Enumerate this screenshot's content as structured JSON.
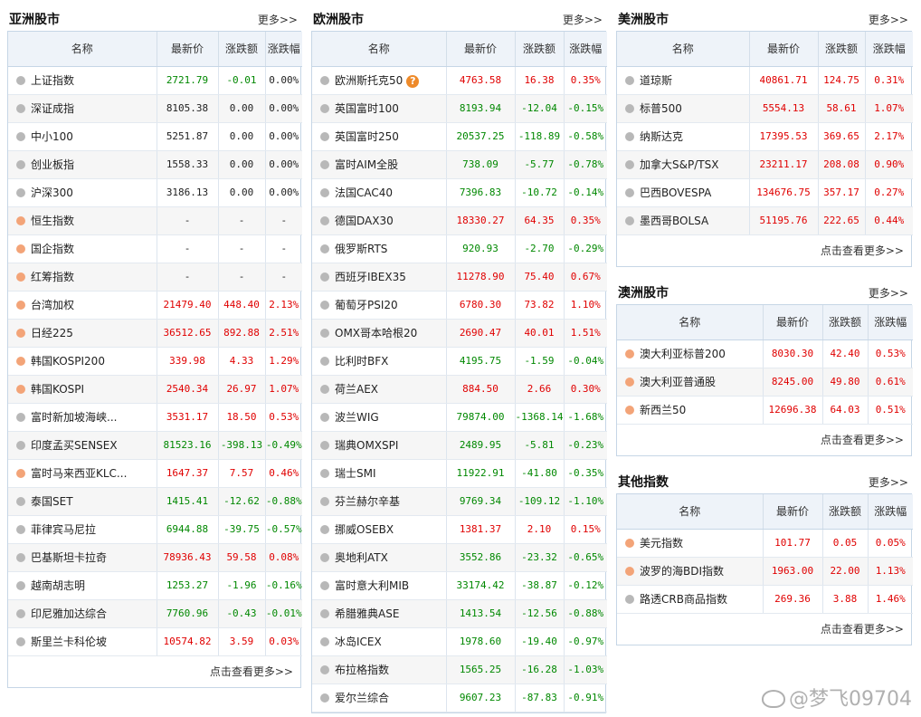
{
  "asia": {
    "title": "亚洲股市",
    "more": "更多>>",
    "headers": [
      "名称",
      "最新价",
      "涨跌额",
      "涨跌幅"
    ],
    "rows": [
      {
        "name": "上证指数",
        "price": "2721.79",
        "change": "-0.01",
        "pct": "0.00%",
        "dot": "gray",
        "dir": "down",
        "pdir": "flat"
      },
      {
        "name": "深证成指",
        "price": "8105.38",
        "change": "0.00",
        "pct": "0.00%",
        "dot": "gray",
        "dir": "flat",
        "pdir": "flat"
      },
      {
        "name": "中小100",
        "price": "5251.87",
        "change": "0.00",
        "pct": "0.00%",
        "dot": "gray",
        "dir": "flat",
        "pdir": "flat"
      },
      {
        "name": "创业板指",
        "price": "1558.33",
        "change": "0.00",
        "pct": "0.00%",
        "dot": "gray",
        "dir": "flat",
        "pdir": "flat"
      },
      {
        "name": "沪深300",
        "price": "3186.13",
        "change": "0.00",
        "pct": "0.00%",
        "dot": "gray",
        "dir": "flat",
        "pdir": "flat"
      },
      {
        "name": "恒生指数",
        "price": "-",
        "change": "-",
        "pct": "-",
        "dot": "orange",
        "dir": "flat",
        "pdir": "flat"
      },
      {
        "name": "国企指数",
        "price": "-",
        "change": "-",
        "pct": "-",
        "dot": "orange",
        "dir": "flat",
        "pdir": "flat"
      },
      {
        "name": "红筹指数",
        "price": "-",
        "change": "-",
        "pct": "-",
        "dot": "orange",
        "dir": "flat",
        "pdir": "flat"
      },
      {
        "name": "台湾加权",
        "price": "21479.40",
        "change": "448.40",
        "pct": "2.13%",
        "dot": "orange",
        "dir": "up",
        "pdir": "up"
      },
      {
        "name": "日经225",
        "price": "36512.65",
        "change": "892.88",
        "pct": "2.51%",
        "dot": "orange",
        "dir": "up",
        "pdir": "up"
      },
      {
        "name": "韩国KOSPI200",
        "price": "339.98",
        "change": "4.33",
        "pct": "1.29%",
        "dot": "orange",
        "dir": "up",
        "pdir": "up"
      },
      {
        "name": "韩国KOSPI",
        "price": "2540.34",
        "change": "26.97",
        "pct": "1.07%",
        "dot": "orange",
        "dir": "up",
        "pdir": "up"
      },
      {
        "name": "富时新加坡海峡...",
        "price": "3531.17",
        "change": "18.50",
        "pct": "0.53%",
        "dot": "gray",
        "dir": "up",
        "pdir": "up"
      },
      {
        "name": "印度孟买SENSEX",
        "price": "81523.16",
        "change": "-398.13",
        "pct": "-0.49%",
        "dot": "gray",
        "dir": "down",
        "pdir": "down"
      },
      {
        "name": "富时马来西亚KLC...",
        "price": "1647.37",
        "change": "7.57",
        "pct": "0.46%",
        "dot": "orange",
        "dir": "up",
        "pdir": "up"
      },
      {
        "name": "泰国SET",
        "price": "1415.41",
        "change": "-12.62",
        "pct": "-0.88%",
        "dot": "gray",
        "dir": "down",
        "pdir": "down"
      },
      {
        "name": "菲律宾马尼拉",
        "price": "6944.88",
        "change": "-39.75",
        "pct": "-0.57%",
        "dot": "gray",
        "dir": "down",
        "pdir": "down"
      },
      {
        "name": "巴基斯坦卡拉奇",
        "price": "78936.43",
        "change": "59.58",
        "pct": "0.08%",
        "dot": "gray",
        "dir": "up",
        "pdir": "up"
      },
      {
        "name": "越南胡志明",
        "price": "1253.27",
        "change": "-1.96",
        "pct": "-0.16%",
        "dot": "gray",
        "dir": "down",
        "pdir": "down"
      },
      {
        "name": "印尼雅加达综合",
        "price": "7760.96",
        "change": "-0.43",
        "pct": "-0.01%",
        "dot": "gray",
        "dir": "down",
        "pdir": "down"
      },
      {
        "name": "斯里兰卡科伦坡",
        "price": "10574.82",
        "change": "3.59",
        "pct": "0.03%",
        "dot": "gray",
        "dir": "up",
        "pdir": "up"
      }
    ],
    "footer": "点击查看更多>>"
  },
  "europe": {
    "title": "欧洲股市",
    "more": "更多>>",
    "headers": [
      "名称",
      "最新价",
      "涨跌额",
      "涨跌幅"
    ],
    "rows": [
      {
        "name": "欧洲斯托克50",
        "price": "4763.58",
        "change": "16.38",
        "pct": "0.35%",
        "dot": "gray",
        "dir": "up",
        "pdir": "up",
        "help": "?"
      },
      {
        "name": "英国富时100",
        "price": "8193.94",
        "change": "-12.04",
        "pct": "-0.15%",
        "dot": "gray",
        "dir": "down",
        "pdir": "down"
      },
      {
        "name": "英国富时250",
        "price": "20537.25",
        "change": "-118.89",
        "pct": "-0.58%",
        "dot": "gray",
        "dir": "down",
        "pdir": "down"
      },
      {
        "name": "富时AIM全股",
        "price": "738.09",
        "change": "-5.77",
        "pct": "-0.78%",
        "dot": "gray",
        "dir": "down",
        "pdir": "down"
      },
      {
        "name": "法国CAC40",
        "price": "7396.83",
        "change": "-10.72",
        "pct": "-0.14%",
        "dot": "gray",
        "dir": "down",
        "pdir": "down"
      },
      {
        "name": "德国DAX30",
        "price": "18330.27",
        "change": "64.35",
        "pct": "0.35%",
        "dot": "gray",
        "dir": "up",
        "pdir": "up"
      },
      {
        "name": "俄罗斯RTS",
        "price": "920.93",
        "change": "-2.70",
        "pct": "-0.29%",
        "dot": "gray",
        "dir": "down",
        "pdir": "down"
      },
      {
        "name": "西班牙IBEX35",
        "price": "11278.90",
        "change": "75.40",
        "pct": "0.67%",
        "dot": "gray",
        "dir": "up",
        "pdir": "up"
      },
      {
        "name": "葡萄牙PSI20",
        "price": "6780.30",
        "change": "73.82",
        "pct": "1.10%",
        "dot": "gray",
        "dir": "up",
        "pdir": "up"
      },
      {
        "name": "OMX哥本哈根20",
        "price": "2690.47",
        "change": "40.01",
        "pct": "1.51%",
        "dot": "gray",
        "dir": "up",
        "pdir": "up"
      },
      {
        "name": "比利时BFX",
        "price": "4195.75",
        "change": "-1.59",
        "pct": "-0.04%",
        "dot": "gray",
        "dir": "down",
        "pdir": "down"
      },
      {
        "name": "荷兰AEX",
        "price": "884.50",
        "change": "2.66",
        "pct": "0.30%",
        "dot": "gray",
        "dir": "up",
        "pdir": "up"
      },
      {
        "name": "波兰WIG",
        "price": "79874.00",
        "change": "-1368.14",
        "pct": "-1.68%",
        "dot": "gray",
        "dir": "down",
        "pdir": "down"
      },
      {
        "name": "瑞典OMXSPI",
        "price": "2489.95",
        "change": "-5.81",
        "pct": "-0.23%",
        "dot": "gray",
        "dir": "down",
        "pdir": "down"
      },
      {
        "name": "瑞士SMI",
        "price": "11922.91",
        "change": "-41.80",
        "pct": "-0.35%",
        "dot": "gray",
        "dir": "down",
        "pdir": "down"
      },
      {
        "name": "芬兰赫尔辛基",
        "price": "9769.34",
        "change": "-109.12",
        "pct": "-1.10%",
        "dot": "gray",
        "dir": "down",
        "pdir": "down"
      },
      {
        "name": "挪威OSEBX",
        "price": "1381.37",
        "change": "2.10",
        "pct": "0.15%",
        "dot": "gray",
        "dir": "up",
        "pdir": "up"
      },
      {
        "name": "奥地利ATX",
        "price": "3552.86",
        "change": "-23.32",
        "pct": "-0.65%",
        "dot": "gray",
        "dir": "down",
        "pdir": "down"
      },
      {
        "name": "富时意大利MIB",
        "price": "33174.42",
        "change": "-38.87",
        "pct": "-0.12%",
        "dot": "gray",
        "dir": "down",
        "pdir": "down"
      },
      {
        "name": "希腊雅典ASE",
        "price": "1413.54",
        "change": "-12.56",
        "pct": "-0.88%",
        "dot": "gray",
        "dir": "down",
        "pdir": "down"
      },
      {
        "name": "冰岛ICEX",
        "price": "1978.60",
        "change": "-19.40",
        "pct": "-0.97%",
        "dot": "gray",
        "dir": "down",
        "pdir": "down"
      },
      {
        "name": "布拉格指数",
        "price": "1565.25",
        "change": "-16.28",
        "pct": "-1.03%",
        "dot": "gray",
        "dir": "down",
        "pdir": "down"
      },
      {
        "name": "爱尔兰综合",
        "price": "9607.23",
        "change": "-87.83",
        "pct": "-0.91%",
        "dot": "gray",
        "dir": "down",
        "pdir": "down"
      }
    ]
  },
  "america": {
    "title": "美洲股市",
    "more": "更多>>",
    "headers": [
      "名称",
      "最新价",
      "涨跌额",
      "涨跌幅"
    ],
    "rows": [
      {
        "name": "道琼斯",
        "price": "40861.71",
        "change": "124.75",
        "pct": "0.31%",
        "dot": "gray",
        "dir": "up",
        "pdir": "up"
      },
      {
        "name": "标普500",
        "price": "5554.13",
        "change": "58.61",
        "pct": "1.07%",
        "dot": "gray",
        "dir": "up",
        "pdir": "up"
      },
      {
        "name": "纳斯达克",
        "price": "17395.53",
        "change": "369.65",
        "pct": "2.17%",
        "dot": "gray",
        "dir": "up",
        "pdir": "up"
      },
      {
        "name": "加拿大S&P/TSX",
        "price": "23211.17",
        "change": "208.08",
        "pct": "0.90%",
        "dot": "gray",
        "dir": "up",
        "pdir": "up"
      },
      {
        "name": "巴西BOVESPA",
        "price": "134676.75",
        "change": "357.17",
        "pct": "0.27%",
        "dot": "gray",
        "dir": "up",
        "pdir": "up"
      },
      {
        "name": "墨西哥BOLSA",
        "price": "51195.76",
        "change": "222.65",
        "pct": "0.44%",
        "dot": "gray",
        "dir": "up",
        "pdir": "up"
      }
    ],
    "footer": "点击查看更多>>"
  },
  "australia": {
    "title": "澳洲股市",
    "more": "更多>>",
    "headers": [
      "名称",
      "最新价",
      "涨跌额",
      "涨跌幅"
    ],
    "rows": [
      {
        "name": "澳大利亚标普200",
        "price": "8030.30",
        "change": "42.40",
        "pct": "0.53%",
        "dot": "orange",
        "dir": "up",
        "pdir": "up"
      },
      {
        "name": "澳大利亚普通股",
        "price": "8245.00",
        "change": "49.80",
        "pct": "0.61%",
        "dot": "orange",
        "dir": "up",
        "pdir": "up"
      },
      {
        "name": "新西兰50",
        "price": "12696.38",
        "change": "64.03",
        "pct": "0.51%",
        "dot": "orange",
        "dir": "up",
        "pdir": "up"
      }
    ],
    "footer": "点击查看更多>>"
  },
  "other": {
    "title": "其他指数",
    "more": "更多>>",
    "headers": [
      "名称",
      "最新价",
      "涨跌额",
      "涨跌幅"
    ],
    "rows": [
      {
        "name": "美元指数",
        "price": "101.77",
        "change": "0.05",
        "pct": "0.05%",
        "dot": "orange",
        "dir": "up",
        "pdir": "up"
      },
      {
        "name": "波罗的海BDI指数",
        "price": "1963.00",
        "change": "22.00",
        "pct": "1.13%",
        "dot": "orange",
        "dir": "up",
        "pdir": "up"
      },
      {
        "name": "路透CRB商品指数",
        "price": "269.36",
        "change": "3.88",
        "pct": "1.46%",
        "dot": "gray",
        "dir": "up",
        "pdir": "up"
      }
    ],
    "footer": "点击查看更多>>"
  },
  "watermark": {
    "text": "@梦飞09704"
  },
  "colors": {
    "up": "#e00000",
    "down": "#008800",
    "header_bg": "#eef3f9",
    "border": "#c6d6e6"
  }
}
